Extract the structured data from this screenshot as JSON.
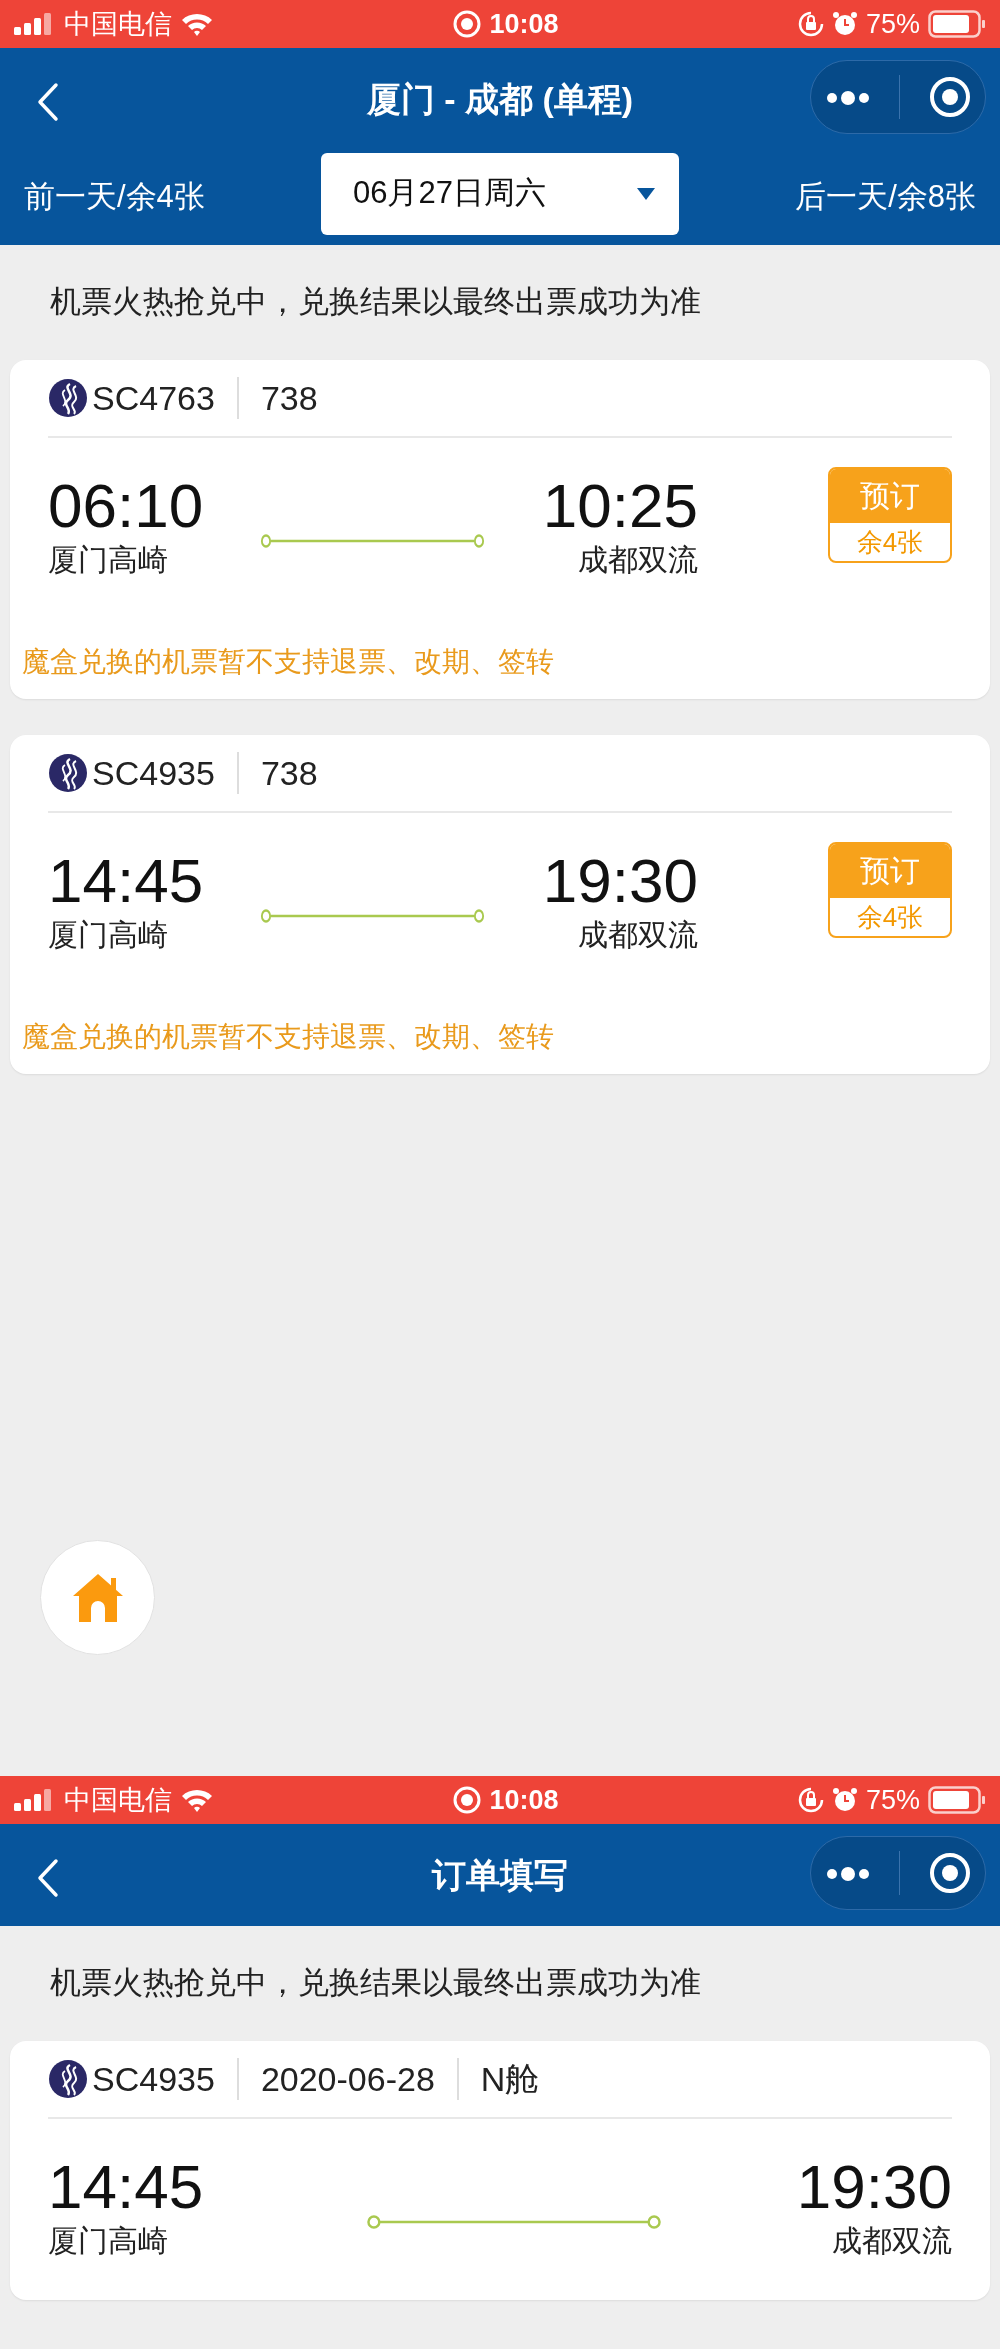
{
  "screens": [
    {
      "status_bar": {
        "carrier": "中国电信",
        "time": "10:08",
        "battery": "75%"
      },
      "nav": {
        "title": "厦门 - 成都 (单程)"
      },
      "date_bar": {
        "prev": "前一天/余4张",
        "date": "06月27日周六",
        "next": "后一天/余8张"
      },
      "notice": "机票火热抢兑中，兑换结果以最终出票成功为准",
      "flights": [
        {
          "flight_no": "SC4763",
          "details": [
            "738"
          ],
          "depart_time": "06:10",
          "depart_airport": "厦门高崎",
          "arrive_time": "10:25",
          "arrive_airport": "成都双流",
          "book": {
            "label": "预订",
            "remaining": "余4张"
          },
          "note": "魔盒兑换的机票暂不支持退票、改期、签转"
        },
        {
          "flight_no": "SC4935",
          "details": [
            "738"
          ],
          "depart_time": "14:45",
          "depart_airport": "厦门高崎",
          "arrive_time": "19:30",
          "arrive_airport": "成都双流",
          "book": {
            "label": "预订",
            "remaining": "余4张"
          },
          "note": "魔盒兑换的机票暂不支持退票、改期、签转"
        }
      ],
      "home_button": true
    },
    {
      "status_bar": {
        "carrier": "中国电信",
        "time": "10:08",
        "battery": "75%"
      },
      "nav": {
        "title": "订单填写"
      },
      "notice": "机票火热抢兑中，兑换结果以最终出票成功为准",
      "flights": [
        {
          "flight_no": "SC4935",
          "details": [
            "2020-06-28",
            "N舱"
          ],
          "depart_time": "14:45",
          "depart_airport": "厦门高崎",
          "arrive_time": "19:30",
          "arrive_airport": "成都双流"
        }
      ]
    }
  ]
}
